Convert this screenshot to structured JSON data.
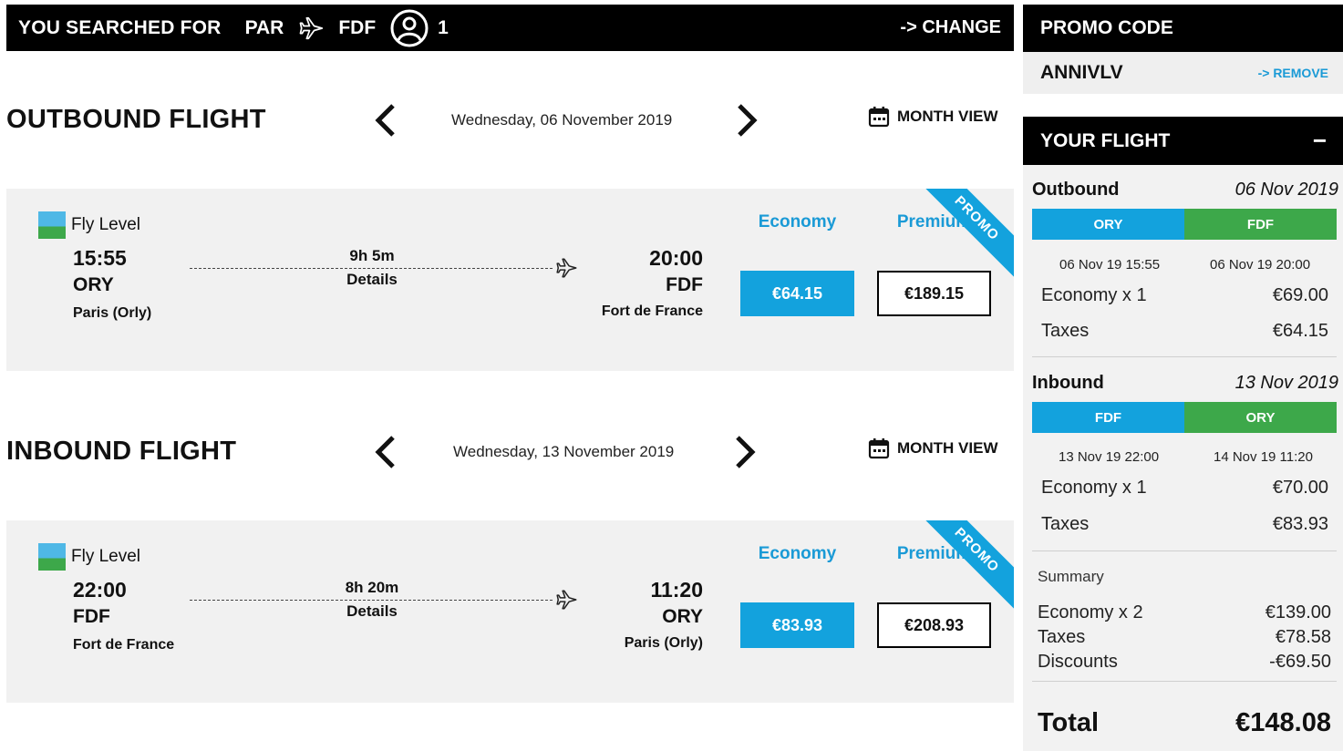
{
  "search": {
    "label": "YOU SEARCHED FOR",
    "origin": "PAR",
    "destination": "FDF",
    "passengers": "1",
    "change": "-> CHANGE"
  },
  "outbound": {
    "title": "OUTBOUND FLIGHT",
    "date": "Wednesday, 06 November 2019",
    "month_view": "MONTH VIEW",
    "airline": "Fly Level",
    "dep_time": "15:55",
    "dep_code": "ORY",
    "dep_city": "Paris (Orly)",
    "duration": "9h 5m",
    "details": "Details",
    "arr_time": "20:00",
    "arr_code": "FDF",
    "arr_city": "Fort de France",
    "economy_label": "Economy",
    "premium_label": "Premium",
    "economy_price": "€64.15",
    "premium_price": "€189.15",
    "promo": "PROMO"
  },
  "inbound": {
    "title": "INBOUND FLIGHT",
    "date": "Wednesday, 13 November 2019",
    "month_view": "MONTH VIEW",
    "airline": "Fly Level",
    "dep_time": "22:00",
    "dep_code": "FDF",
    "dep_city": "Fort de France",
    "duration": "8h 20m",
    "details": "Details",
    "arr_time": "11:20",
    "arr_code": "ORY",
    "arr_city": "Paris (Orly)",
    "economy_label": "Economy",
    "premium_label": "Premium",
    "economy_price": "€83.93",
    "premium_price": "€208.93",
    "promo": "PROMO"
  },
  "sidebar": {
    "promo_title": "PROMO CODE",
    "promo_code": "ANNIVLV",
    "remove": "-> REMOVE",
    "flight_title": "YOUR FLIGHT",
    "collapse": "−",
    "outbound": {
      "title": "Outbound",
      "date": "06 Nov 2019",
      "from": "ORY",
      "to": "FDF",
      "dep_dt": "06 Nov 19 15:55",
      "arr_dt": "06 Nov 19 20:00",
      "fare_label": "Economy x 1",
      "fare_value": "€69.00",
      "taxes_label": "Taxes",
      "taxes_value": "€64.15"
    },
    "inbound": {
      "title": "Inbound",
      "date": "13 Nov 2019",
      "from": "FDF",
      "to": "ORY",
      "dep_dt": "13 Nov 19 22:00",
      "arr_dt": "14 Nov 19 11:20",
      "fare_label": "Economy x 1",
      "fare_value": "€70.00",
      "taxes_label": "Taxes",
      "taxes_value": "€83.93"
    },
    "summary": {
      "title": "Summary",
      "fare_label": "Economy x 2",
      "fare_value": "€139.00",
      "taxes_label": "Taxes",
      "taxes_value": "€78.58",
      "discounts_label": "Discounts",
      "discounts_value": "-€69.50",
      "total_label": "Total",
      "total_value": "€148.08"
    }
  },
  "colors": {
    "accent_blue": "#13a2dd",
    "accent_green": "#3da84a",
    "header_black": "#000000"
  }
}
